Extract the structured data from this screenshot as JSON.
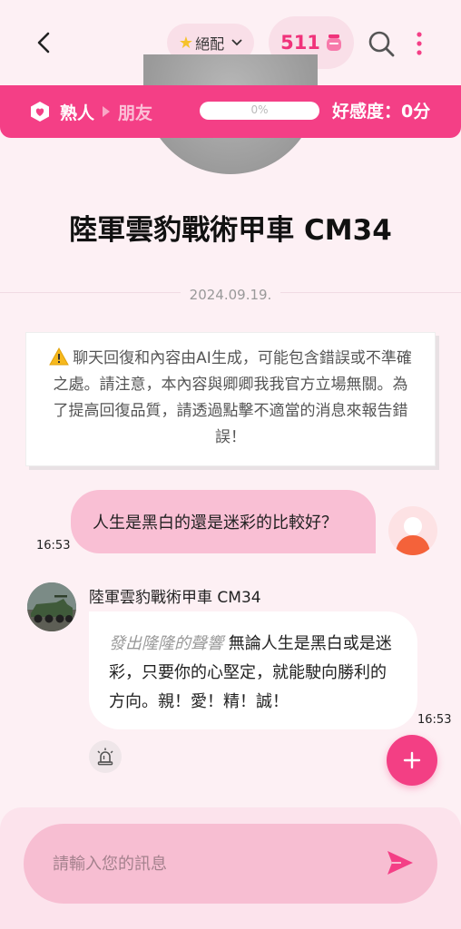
{
  "header": {
    "model_label": "絕配",
    "coins": "511"
  },
  "relationship": {
    "stage": "熟人",
    "next_stage": "朋友",
    "progress_label": "0%",
    "progress": 0,
    "favorability": "好感度：0分"
  },
  "character": {
    "name": "陸軍雲豹戰術甲車 CM34"
  },
  "chat": {
    "date": "2024.09.19.",
    "notice": "聊天回復和內容由AI生成，可能包含錯誤或不準確之處。請注意，本內容與卿卿我我官方立場無關。為了提高回復品質，請透過點擊不適當的消息來報告錯誤！",
    "user_message": "人生是黑白的還是迷彩的比較好？",
    "user_time": "16:53",
    "bot_action": "發出隆隆的聲響",
    "bot_message": " 無論人生是黑白或是迷彩，只要你的心堅定，就能駛向勝利的方向。親！愛！精！誠！",
    "bot_time": "16:53"
  },
  "composer": {
    "placeholder": "請輸入您的訊息"
  },
  "colors": {
    "accent": "#f43f86",
    "background": "#fdf0f4",
    "user_bubble": "#f9bfd4"
  }
}
